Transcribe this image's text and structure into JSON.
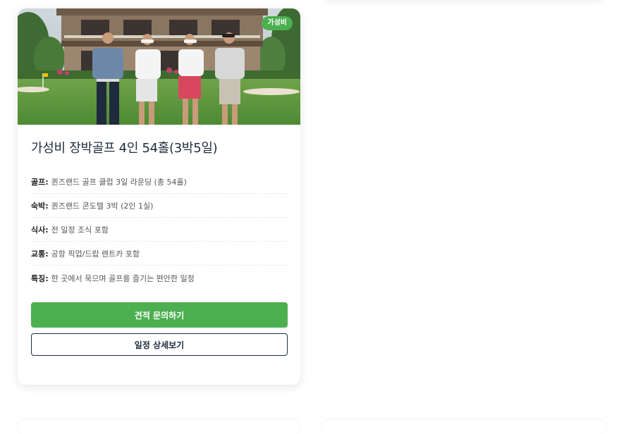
{
  "card": {
    "badge": "가성비",
    "title": "가성비 장박골프 4인 54홀(3박5일)",
    "details": [
      {
        "key": "골프:",
        "value": "퀸즈랜드 골프 클럽 3일 라운딩 (총 54홀)"
      },
      {
        "key": "숙박:",
        "value": "퀸즈랜드 콘도텔 3박 (2인 1실)"
      },
      {
        "key": "식사:",
        "value": "전 일정 조식 포함"
      },
      {
        "key": "교통:",
        "value": "공항 픽업/드랍 렌트카 포함"
      },
      {
        "key": "특징:",
        "value": "한 곳에서 묵으며 골프를 즐기는 편안한 일정"
      }
    ],
    "primary_button": "견적 문의하기",
    "secondary_button": "일정 상세보기"
  },
  "colors": {
    "accent": "#4caf50",
    "title": "#1f2d3d"
  }
}
